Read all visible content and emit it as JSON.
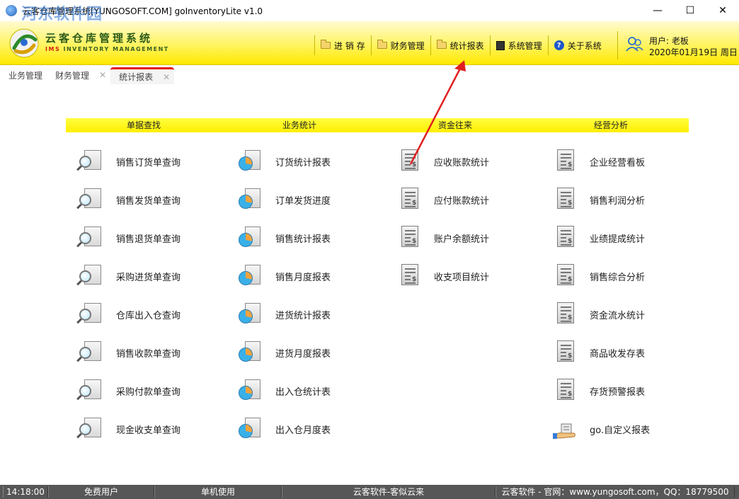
{
  "window": {
    "title": "云客仓库管理系统[YUNGOSOFT.COM]  goInventoryLite v1.0",
    "watermark": "河东软件园",
    "controls": {
      "minimize": "—",
      "maximize": "☐",
      "close": "✕"
    }
  },
  "brand": {
    "name": "云客仓库管理系统",
    "sub_prefix": "IMS",
    "sub_rest": " INVENTORY MANAGEMENT"
  },
  "topnav": [
    {
      "label": "进 销 存",
      "icon": "folder-icon"
    },
    {
      "label": "财务管理",
      "icon": "folder-icon"
    },
    {
      "label": "统计报表",
      "icon": "folder-icon"
    },
    {
      "label": "系统管理",
      "icon": "system-icon"
    },
    {
      "label": "关于系统",
      "icon": "help-icon"
    }
  ],
  "user": {
    "name": "用户: 老板",
    "date": "2020年01月19日 周日"
  },
  "tabs": [
    {
      "label": "业务管理",
      "closable": false
    },
    {
      "label": "财务管理",
      "closable": true
    },
    {
      "label": "统计报表",
      "closable": true,
      "active": true
    }
  ],
  "tab_close_glyph": "✕",
  "sections": [
    "单据查找",
    "业务统计",
    "资金往来",
    "经营分析"
  ],
  "columns": {
    "search": [
      "销售订货单查询",
      "销售发货单查询",
      "销售退货单查询",
      "采购进货单查询",
      "仓库出入仓查询",
      "销售收款单查询",
      "采购付款单查询",
      "现金收支单查询"
    ],
    "business": [
      "订货统计报表",
      "订单发货进度",
      "销售统计报表",
      "销售月度报表",
      "进货统计报表",
      "进货月度报表",
      "出入仓统计表",
      "出入仓月度表"
    ],
    "funds": [
      "应收账款统计",
      "应付账款统计",
      "账户余额统计",
      "收支项目统计"
    ],
    "analysis": [
      "企业经营看板",
      "销售利润分析",
      "业绩提成统计",
      "销售综合分析",
      "资金流水统计",
      "商品收发存表",
      "存货预警报表",
      "go.自定义报表"
    ]
  },
  "statusbar": {
    "time": "14:18:00",
    "user_type": "免费用户",
    "mode": "单机使用",
    "slogan": "云客软件-客似云来",
    "website": "云客软件 - 官网：www.yungosoft.com，QQ：18779500"
  },
  "colors": {
    "header_yellow": "#fff460",
    "section_yellow": "#ffff40",
    "active_tab_red": "#e61414",
    "arrow_red": "#e02020",
    "statusbar_gray": "#575757"
  }
}
